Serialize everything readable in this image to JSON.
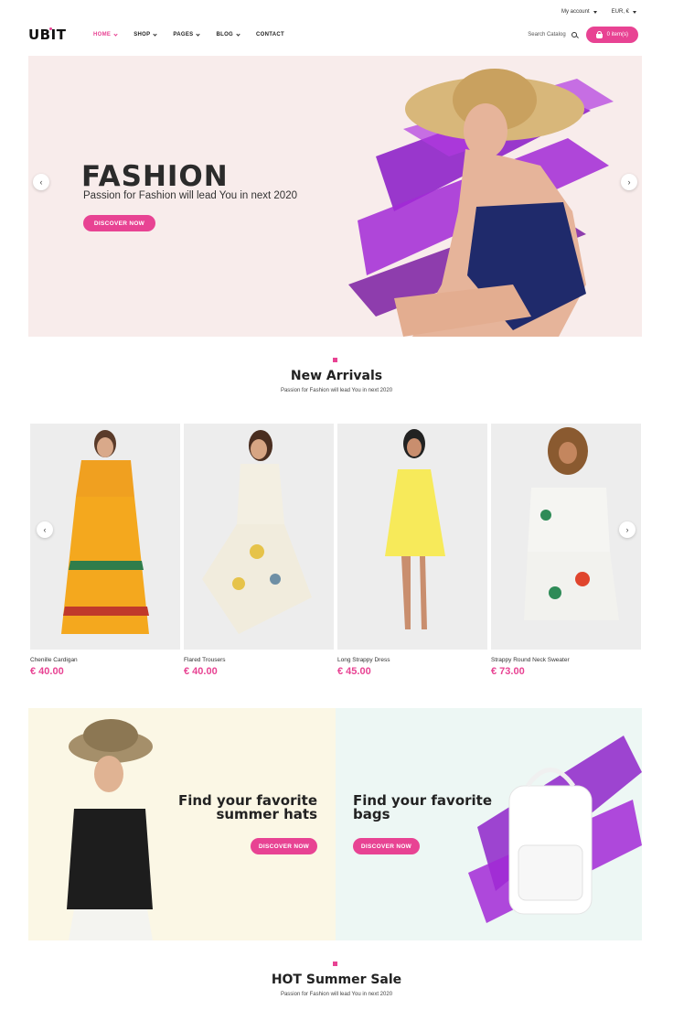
{
  "topbar": {
    "account": "My account",
    "currency": "EUR, €"
  },
  "header": {
    "logo": "UBIT",
    "nav": [
      {
        "label": "HOME",
        "dropdown": true,
        "active": true
      },
      {
        "label": "SHOP",
        "dropdown": true
      },
      {
        "label": "PAGES",
        "dropdown": true
      },
      {
        "label": "BLOG",
        "dropdown": true
      },
      {
        "label": "CONTACT",
        "dropdown": false
      }
    ],
    "search_placeholder": "Search Catalog",
    "cart_label": "0 item(s)"
  },
  "hero": {
    "title": "FASHION",
    "subtitle": "Passion for Fashion will lead You in next 2020",
    "button": "DISCOVER NOW",
    "prev_icon": "chevron-left-icon",
    "next_icon": "chevron-right-icon"
  },
  "new_arrivals": {
    "title": "New Arrivals",
    "subtitle": "Passion for Fashion will lead You in next 2020",
    "products": [
      {
        "name": "Chenille Cardigan",
        "price": "€ 40.00"
      },
      {
        "name": "Flared Trousers",
        "price": "€ 40.00"
      },
      {
        "name": "Long Strappy Dress",
        "price": "€ 45.00"
      },
      {
        "name": "Strappy Round Neck Sweater",
        "price": "€ 73.00"
      }
    ]
  },
  "banners": {
    "left": {
      "title_1": "Find your favorite",
      "title_2": "summer hats",
      "button": "DISCOVER NOW"
    },
    "right": {
      "title_1": "Find your favorite",
      "title_2": "bags",
      "button": "DISCOVER NOW"
    }
  },
  "hot_sale": {
    "title": "HOT Summer Sale",
    "subtitle": "Passion for Fashion will lead You in next 2020"
  },
  "colors": {
    "accent": "#e84393",
    "hero_bg": "#f8eceb",
    "banner_left_bg": "#fbf7e5",
    "banner_right_bg": "#edf7f4",
    "brush": "#8e24c9"
  }
}
